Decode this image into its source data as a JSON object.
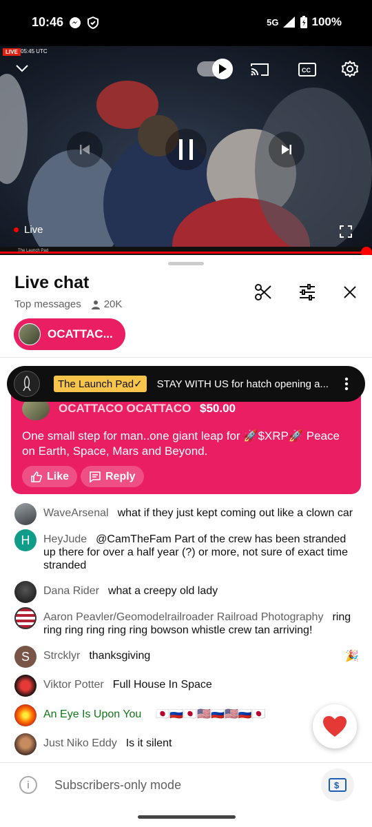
{
  "status": {
    "time": "10:46",
    "network": "5G",
    "battery": "100%"
  },
  "video": {
    "live_tag": "LIVE",
    "live_time": "05:45 UTC",
    "live_label": "Live",
    "ticker_text": "The Launch Pad"
  },
  "chat": {
    "title": "Live chat",
    "mode": "Top messages",
    "viewers": "20K",
    "pinned_chip": "OCATTAC..."
  },
  "banner": {
    "channel": "The Launch Pad",
    "check": "✓",
    "text": "STAY WITH US for hatch opening a..."
  },
  "superchat": {
    "author": "OCATTACO OCATTACO",
    "amount": "$50.00",
    "message": "One small step for man..one giant leap for 🚀$XRP🚀 Peace on Earth, Space, Mars and Beyond.",
    "like_label": "Like",
    "reply_label": "Reply"
  },
  "messages": [
    {
      "author": "WaveArsenal",
      "text": "what if they just kept coming out like a clown car"
    },
    {
      "author": "HeyJude",
      "initial": "H",
      "text": "@CamTheFam Part of the crew has been stranded up there for over a half year (?) or more, not sure of exact time stranded"
    },
    {
      "author": "Dana Rider",
      "text": "what a creepy old lady"
    },
    {
      "author": "Aaron Peavler/Geomodelrailroader Railroad Photography",
      "text": "ring ring ring ring ring ring bowson whistle crew tan arriving!"
    },
    {
      "author": "Strcklyr",
      "initial": "S",
      "text": "thanksgiving",
      "emoji": "🎉"
    },
    {
      "author": "Viktor Potter",
      "text": "Full House In Space"
    },
    {
      "author": "An Eye Is Upon You",
      "text": "🇯🇵🇷🇺🇯🇵🇺🇸🇷🇺🇺🇸🇷🇺🇯🇵"
    },
    {
      "author": "Just Niko Eddy",
      "text": "Is it silent"
    }
  ],
  "input": {
    "placeholder": "Subscribers-only mode"
  },
  "colors": {
    "accent": "#e91e63",
    "live_red": "#ff0000",
    "badge_gold": "#f8c44a"
  }
}
